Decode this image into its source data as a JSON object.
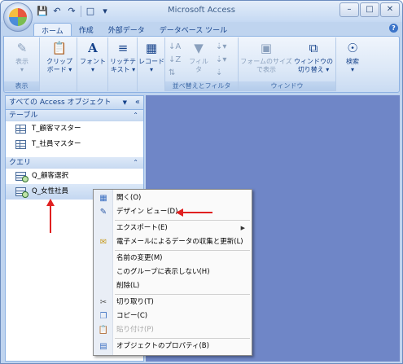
{
  "window": {
    "title": "Microsoft Access"
  },
  "qat": {
    "icons": [
      "save-icon",
      "undo-icon",
      "redo-icon",
      "new-icon",
      "customize-icon"
    ]
  },
  "tabs": [
    {
      "label": "ホーム",
      "active": true
    },
    {
      "label": "作成",
      "active": false
    },
    {
      "label": "外部データ",
      "active": false
    },
    {
      "label": "データベース ツール",
      "active": false
    }
  ],
  "ribbon": {
    "groups": {
      "view": {
        "label": "表示",
        "buttons": [
          {
            "label": "表示"
          }
        ]
      },
      "clipboard": {
        "label": "クリップボード"
      },
      "font": {
        "label": "フォント"
      },
      "rich_text": {
        "label": "リッチテキスト"
      },
      "records": {
        "label": "レコード"
      },
      "sort_filter": {
        "label": "並べ替えとフィルタ",
        "filter_label": "フィルタ"
      },
      "window": {
        "label": "ウィンドウ",
        "fit_form": "フォームのサイズで表示",
        "switch_windows": "ウィンドウの切り替え"
      },
      "find": {
        "label": "検索"
      }
    }
  },
  "nav": {
    "header": "すべての Access オブジェクト",
    "sections": [
      {
        "label": "テーブル",
        "items": [
          "T_顧客マスター",
          "T_社員マスター"
        ]
      },
      {
        "label": "クエリ",
        "items": [
          "Q_顧客選択",
          "Q_女性社員"
        ]
      }
    ],
    "selected": "Q_女性社員"
  },
  "context_menu": {
    "items": [
      {
        "label": "開く(O)",
        "icon": "open-icon",
        "disabled": false
      },
      {
        "label": "デザイン ビュー(D)",
        "icon": "design-view-icon",
        "disabled": false
      },
      {
        "label": "エクスポート(E)",
        "icon": "",
        "disabled": false,
        "submenu": true
      },
      {
        "label": "電子メールによるデータの収集と更新(L)",
        "icon": "email-icon",
        "disabled": false
      },
      {
        "label": "名前の変更(M)",
        "icon": "",
        "disabled": false
      },
      {
        "label": "このグループに表示しない(H)",
        "icon": "",
        "disabled": false
      },
      {
        "label": "削除(L)",
        "icon": "",
        "disabled": false
      },
      {
        "label": "切り取り(T)",
        "icon": "cut-icon",
        "disabled": false
      },
      {
        "label": "コピー(C)",
        "icon": "copy-icon",
        "disabled": false
      },
      {
        "label": "貼り付け(P)",
        "icon": "paste-icon",
        "disabled": true
      },
      {
        "label": "オブジェクトのプロパティ(B)",
        "icon": "properties-icon",
        "disabled": false
      }
    ]
  },
  "colors": {
    "workspace": "#6f86c7",
    "arrow": "#e02020",
    "ribbon_bg": "#dce8f7"
  }
}
